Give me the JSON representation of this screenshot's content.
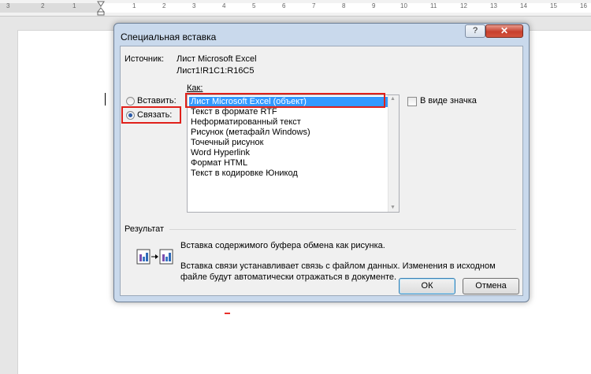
{
  "ruler": {
    "left_ticks": [
      "3",
      "2",
      "1"
    ],
    "right_ticks": [
      "1",
      "2",
      "3",
      "4",
      "5",
      "6",
      "7",
      "8",
      "9",
      "10",
      "11",
      "12",
      "13",
      "14",
      "15",
      "16"
    ]
  },
  "dialog": {
    "title": "Специальная вставка",
    "help_label": "?",
    "close_label": "✕",
    "source_label": "Источник:",
    "source_value_1": "Лист Microsoft Excel",
    "source_value_2": "Лист1!R1C1:R16C5",
    "as_label": "Как:",
    "paste_label": "Вставить:",
    "link_label": "Связать:",
    "as_icon_label": "В виде значка",
    "formats": [
      "Лист Microsoft Excel (объект)",
      "Текст в формате RTF",
      "Неформатированный текст",
      "Рисунок (метафайл Windows)",
      "Точечный рисунок",
      "Word Hyperlink",
      "Формат HTML",
      "Текст в кодировке Юникод"
    ],
    "result_label": "Результат",
    "result_line1": "Вставка содержимого буфера обмена как рисунка.",
    "result_line2": "Вставка связи устанавливает связь с файлом данных. Изменения в исходном",
    "result_line3": "файле будут автоматически отражаться в документе.",
    "ok_label": "ОК",
    "cancel_label": "Отмена"
  },
  "colors": {
    "selection": "#3399ff",
    "highlight_border": "#e0201a",
    "radio_dot": "#2a5aa8"
  }
}
